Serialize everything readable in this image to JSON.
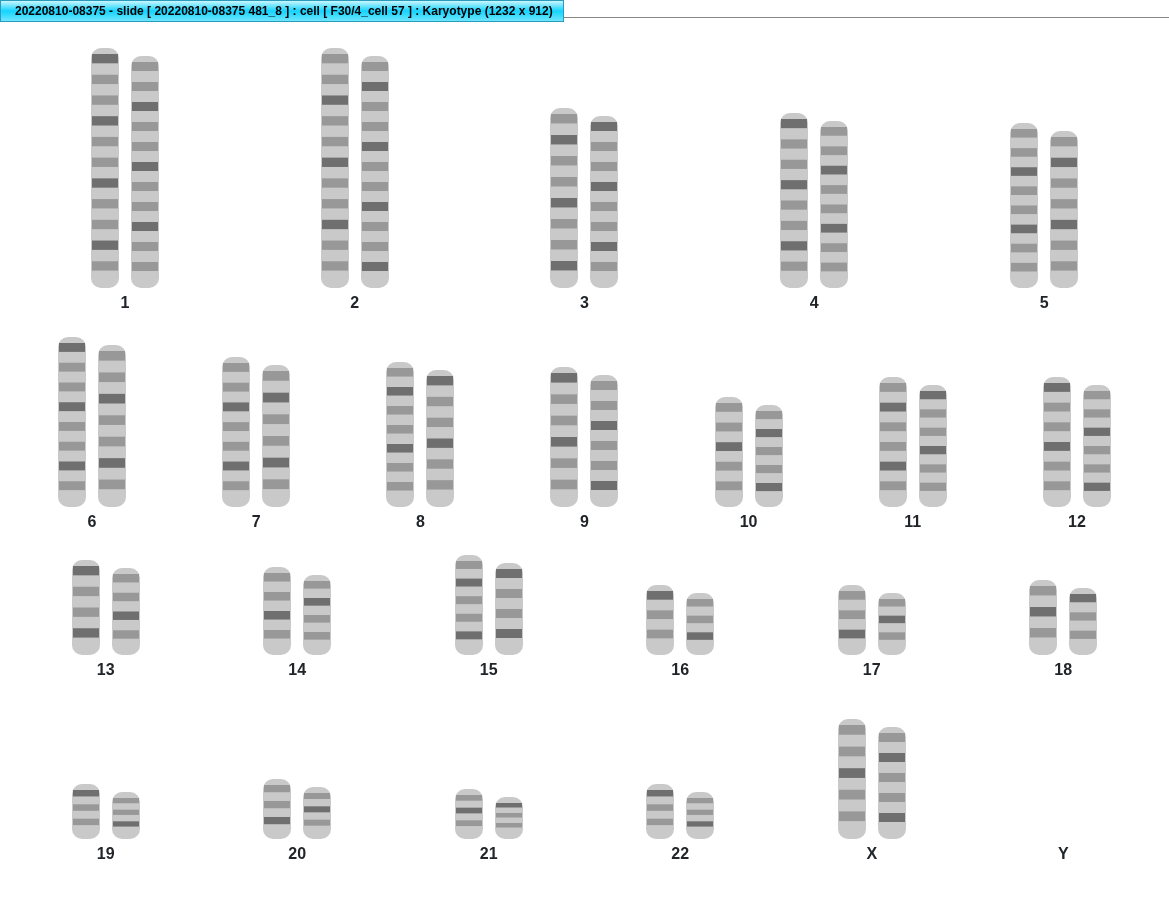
{
  "window": {
    "title": "20220810-08375 - slide [ 20220810-08375 481_8 ] : cell [ F30/4_cell 57 ] : Karyotype  (1232 x 912)"
  },
  "karyotype_rows": [
    {
      "pairs": [
        {
          "label": "1",
          "kind": "pair"
        },
        {
          "label": "2",
          "kind": "pair"
        },
        {
          "label": "3",
          "kind": "pair"
        },
        {
          "label": "4",
          "kind": "pair"
        },
        {
          "label": "5",
          "kind": "pair"
        }
      ]
    },
    {
      "pairs": [
        {
          "label": "6",
          "kind": "pair"
        },
        {
          "label": "7",
          "kind": "pair"
        },
        {
          "label": "8",
          "kind": "pair"
        },
        {
          "label": "9",
          "kind": "pair"
        },
        {
          "label": "10",
          "kind": "pair"
        },
        {
          "label": "11",
          "kind": "pair"
        },
        {
          "label": "12",
          "kind": "pair"
        }
      ]
    },
    {
      "pairs": [
        {
          "label": "13",
          "kind": "pair"
        },
        {
          "label": "14",
          "kind": "pair"
        },
        {
          "label": "15",
          "kind": "pair"
        },
        {
          "label": "16",
          "kind": "pair"
        },
        {
          "label": "17",
          "kind": "pair"
        },
        {
          "label": "18",
          "kind": "pair"
        }
      ]
    },
    {
      "pairs": [
        {
          "label": "19",
          "kind": "pair"
        },
        {
          "label": "20",
          "kind": "pair"
        },
        {
          "label": "21",
          "kind": "pair"
        },
        {
          "label": "22",
          "kind": "pair"
        },
        {
          "label": "X",
          "kind": "pair"
        },
        {
          "label": "Y",
          "kind": "empty"
        }
      ]
    }
  ]
}
